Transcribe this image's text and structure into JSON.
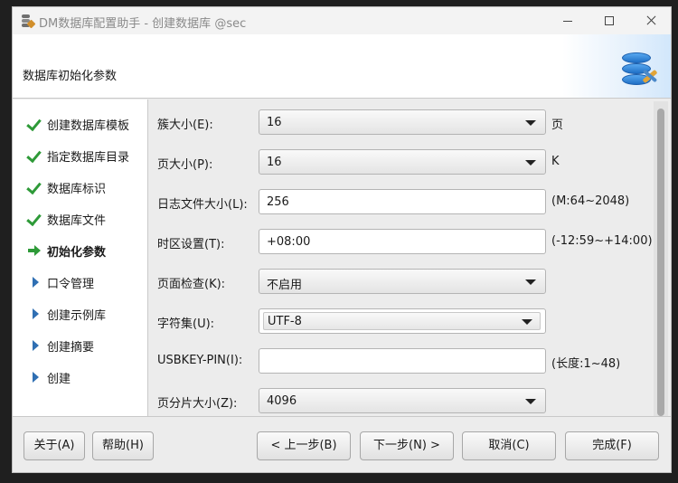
{
  "window": {
    "title": "DM数据库配置助手 - 创建数据库 @sec",
    "controls": [
      "minimize",
      "maximize",
      "close"
    ]
  },
  "header": {
    "title": "数据库初始化参数",
    "logo_icon": "database-tools-icon"
  },
  "steps": [
    {
      "label": "创建数据库模板",
      "status": "done"
    },
    {
      "label": "指定数据库目录",
      "status": "done"
    },
    {
      "label": "数据库标识",
      "status": "done"
    },
    {
      "label": "数据库文件",
      "status": "done"
    },
    {
      "label": "初始化参数",
      "status": "current"
    },
    {
      "label": "口令管理",
      "status": "pending"
    },
    {
      "label": "创建示例库",
      "status": "pending"
    },
    {
      "label": "创建摘要",
      "status": "pending"
    },
    {
      "label": "创建",
      "status": "pending"
    }
  ],
  "form": {
    "extent_size": {
      "label": "簇大小(E):",
      "value": "16",
      "hint": "页"
    },
    "page_size": {
      "label": "页大小(P):",
      "value": "16",
      "hint": "K"
    },
    "log_size": {
      "label": "日志文件大小(L):",
      "value": "256",
      "hint": "(M:64~2048)"
    },
    "time_zone": {
      "label": "时区设置(T):",
      "value": "+08:00",
      "hint": "(-12:59~+14:00)"
    },
    "page_check": {
      "label": "页面检查(K):",
      "value": "不启用"
    },
    "charset": {
      "label": "字符集(U):",
      "value": "UTF-8"
    },
    "usbkey_pin": {
      "label": "USBKEY-PIN(I):",
      "value": "",
      "hint": "(长度:1~48)"
    },
    "hp_size": {
      "label": "页分片大小(Z):",
      "value": "4096"
    }
  },
  "footer": {
    "about": "关于(A)",
    "help": "帮助(H)",
    "prev": "< 上一步(B)",
    "next": "下一步(N) >",
    "cancel": "取消(C)",
    "finish": "完成(F)"
  },
  "colors": {
    "check_green": "#2e9a38",
    "pending_blue": "#2f6fb3",
    "header_accent": "#1f6fc6"
  }
}
